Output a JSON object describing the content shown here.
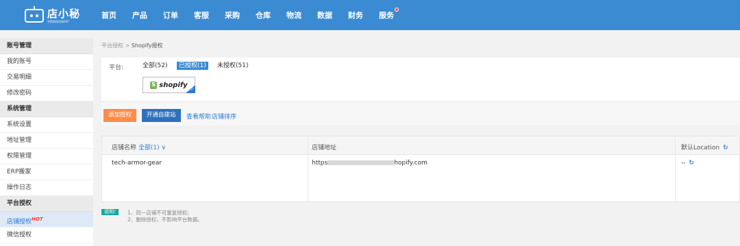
{
  "brand": {
    "name": "店小秘",
    "sub": "免费跨境电商ERP"
  },
  "nav": [
    "首页",
    "产品",
    "订单",
    "客服",
    "采购",
    "仓库",
    "物流",
    "数据",
    "财务",
    "服务"
  ],
  "sidebar": {
    "group1": "账号管理",
    "group1_items": [
      "我的账号",
      "交易明细",
      "修改密码"
    ],
    "group2": "系统管理",
    "group2_items": [
      "系统设置",
      "地址管理",
      "权限管理",
      "ERP搬家",
      "操作日志"
    ],
    "group3": "平台授权",
    "active_item": "店铺授权",
    "hot": "HOT",
    "last_item": "微信授权"
  },
  "breadcrumb": {
    "parent": "平台授权",
    "sep": ">",
    "current": "Shopify授权"
  },
  "platform": {
    "label": "平台:",
    "filters": [
      "全部(52)",
      "已授权(1)",
      "未授权(51)"
    ],
    "selected": "shopify",
    "check": "✓"
  },
  "actions": {
    "add": "添加授权",
    "open_site": "开通自建站",
    "help": "查看帮助",
    "sort": "店铺排序"
  },
  "table": {
    "col_store": "店铺名称",
    "store_filter": "全部(1) ∨",
    "col_url": "店铺地址",
    "col_location": "默认Location",
    "refresh": "↻",
    "rows": [
      {
        "store": "tech-armor-gear",
        "url_prefix": "https",
        "url_suffix": "hopify.com",
        "location": "--"
      }
    ]
  },
  "notes": {
    "badge": "说明!",
    "lines": [
      "1、同一店铺不可重复授权;",
      "2、删除授权，不影响平台数据。"
    ]
  }
}
